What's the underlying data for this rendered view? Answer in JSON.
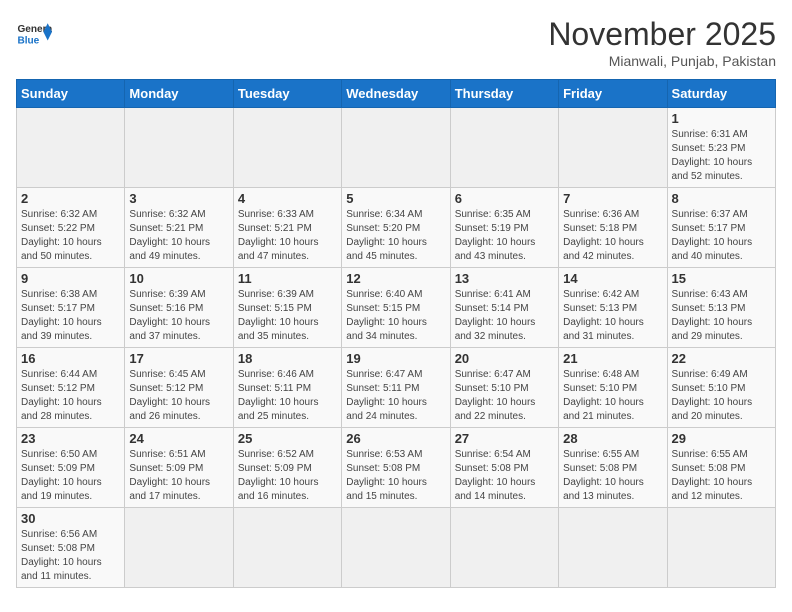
{
  "header": {
    "logo_general": "General",
    "logo_blue": "Blue",
    "month_title": "November 2025",
    "location": "Mianwali, Punjab, Pakistan"
  },
  "days_of_week": [
    "Sunday",
    "Monday",
    "Tuesday",
    "Wednesday",
    "Thursday",
    "Friday",
    "Saturday"
  ],
  "weeks": [
    [
      null,
      null,
      null,
      null,
      null,
      null,
      {
        "day": "1",
        "sunrise": "6:31 AM",
        "sunset": "5:23 PM",
        "daylight": "10 hours and 52 minutes."
      }
    ],
    [
      {
        "day": "2",
        "sunrise": "6:32 AM",
        "sunset": "5:22 PM",
        "daylight": "10 hours and 50 minutes."
      },
      {
        "day": "3",
        "sunrise": "6:32 AM",
        "sunset": "5:21 PM",
        "daylight": "10 hours and 49 minutes."
      },
      {
        "day": "4",
        "sunrise": "6:33 AM",
        "sunset": "5:21 PM",
        "daylight": "10 hours and 47 minutes."
      },
      {
        "day": "5",
        "sunrise": "6:34 AM",
        "sunset": "5:20 PM",
        "daylight": "10 hours and 45 minutes."
      },
      {
        "day": "6",
        "sunrise": "6:35 AM",
        "sunset": "5:19 PM",
        "daylight": "10 hours and 43 minutes."
      },
      {
        "day": "7",
        "sunrise": "6:36 AM",
        "sunset": "5:18 PM",
        "daylight": "10 hours and 42 minutes."
      },
      {
        "day": "8",
        "sunrise": "6:37 AM",
        "sunset": "5:17 PM",
        "daylight": "10 hours and 40 minutes."
      }
    ],
    [
      {
        "day": "9",
        "sunrise": "6:38 AM",
        "sunset": "5:17 PM",
        "daylight": "10 hours and 39 minutes."
      },
      {
        "day": "10",
        "sunrise": "6:39 AM",
        "sunset": "5:16 PM",
        "daylight": "10 hours and 37 minutes."
      },
      {
        "day": "11",
        "sunrise": "6:39 AM",
        "sunset": "5:15 PM",
        "daylight": "10 hours and 35 minutes."
      },
      {
        "day": "12",
        "sunrise": "6:40 AM",
        "sunset": "5:15 PM",
        "daylight": "10 hours and 34 minutes."
      },
      {
        "day": "13",
        "sunrise": "6:41 AM",
        "sunset": "5:14 PM",
        "daylight": "10 hours and 32 minutes."
      },
      {
        "day": "14",
        "sunrise": "6:42 AM",
        "sunset": "5:13 PM",
        "daylight": "10 hours and 31 minutes."
      },
      {
        "day": "15",
        "sunrise": "6:43 AM",
        "sunset": "5:13 PM",
        "daylight": "10 hours and 29 minutes."
      }
    ],
    [
      {
        "day": "16",
        "sunrise": "6:44 AM",
        "sunset": "5:12 PM",
        "daylight": "10 hours and 28 minutes."
      },
      {
        "day": "17",
        "sunrise": "6:45 AM",
        "sunset": "5:12 PM",
        "daylight": "10 hours and 26 minutes."
      },
      {
        "day": "18",
        "sunrise": "6:46 AM",
        "sunset": "5:11 PM",
        "daylight": "10 hours and 25 minutes."
      },
      {
        "day": "19",
        "sunrise": "6:47 AM",
        "sunset": "5:11 PM",
        "daylight": "10 hours and 24 minutes."
      },
      {
        "day": "20",
        "sunrise": "6:47 AM",
        "sunset": "5:10 PM",
        "daylight": "10 hours and 22 minutes."
      },
      {
        "day": "21",
        "sunrise": "6:48 AM",
        "sunset": "5:10 PM",
        "daylight": "10 hours and 21 minutes."
      },
      {
        "day": "22",
        "sunrise": "6:49 AM",
        "sunset": "5:10 PM",
        "daylight": "10 hours and 20 minutes."
      }
    ],
    [
      {
        "day": "23",
        "sunrise": "6:50 AM",
        "sunset": "5:09 PM",
        "daylight": "10 hours and 19 minutes."
      },
      {
        "day": "24",
        "sunrise": "6:51 AM",
        "sunset": "5:09 PM",
        "daylight": "10 hours and 17 minutes."
      },
      {
        "day": "25",
        "sunrise": "6:52 AM",
        "sunset": "5:09 PM",
        "daylight": "10 hours and 16 minutes."
      },
      {
        "day": "26",
        "sunrise": "6:53 AM",
        "sunset": "5:08 PM",
        "daylight": "10 hours and 15 minutes."
      },
      {
        "day": "27",
        "sunrise": "6:54 AM",
        "sunset": "5:08 PM",
        "daylight": "10 hours and 14 minutes."
      },
      {
        "day": "28",
        "sunrise": "6:55 AM",
        "sunset": "5:08 PM",
        "daylight": "10 hours and 13 minutes."
      },
      {
        "day": "29",
        "sunrise": "6:55 AM",
        "sunset": "5:08 PM",
        "daylight": "10 hours and 12 minutes."
      }
    ],
    [
      {
        "day": "30",
        "sunrise": "6:56 AM",
        "sunset": "5:08 PM",
        "daylight": "10 hours and 11 minutes."
      },
      null,
      null,
      null,
      null,
      null,
      null
    ]
  ]
}
